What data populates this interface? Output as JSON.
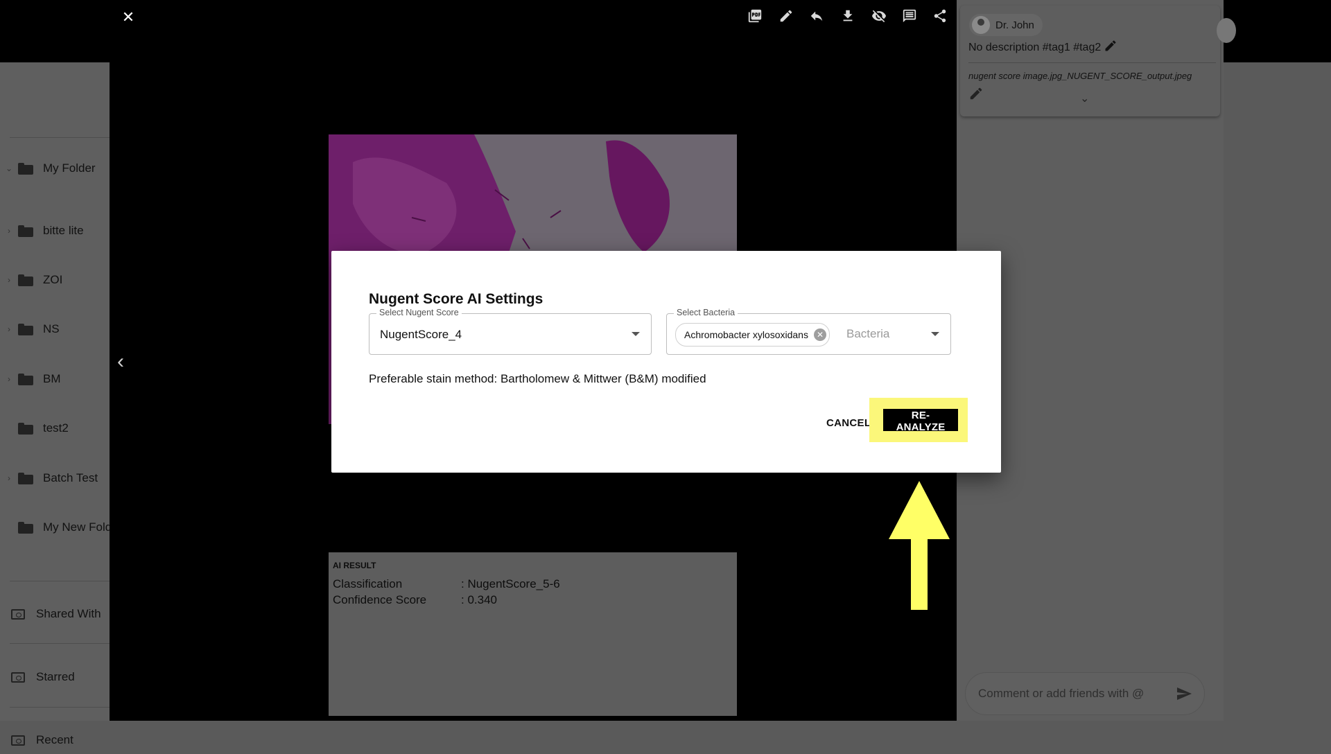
{
  "sidebar": {
    "items": [
      {
        "label": "My Folder",
        "expandable": true
      },
      {
        "label": "bitte lite",
        "expandable": true
      },
      {
        "label": "ZOI",
        "expandable": true
      },
      {
        "label": "NS",
        "expandable": true
      },
      {
        "label": "BM",
        "expandable": true
      },
      {
        "label": "test2",
        "expandable": false
      },
      {
        "label": "Batch Test",
        "expandable": true
      },
      {
        "label": "My New Folder",
        "expandable": false
      }
    ],
    "bottom_items": [
      {
        "label": "Shared With Me"
      },
      {
        "label": "Starred"
      },
      {
        "label": "Recent"
      }
    ]
  },
  "viewer": {
    "toolbar": [
      "pdf-icon",
      "pencil-icon",
      "reply-icon",
      "download-icon",
      "visibility-off-icon",
      "comment-icon",
      "share-icon"
    ],
    "close_glyph": "✕",
    "prev_glyph": "‹",
    "ai_result": {
      "title": "AI RESULT",
      "rows": [
        {
          "key": "Classification",
          "value": ": NugentScore_5-6"
        },
        {
          "key": "Confidence Score",
          "value": ": 0.340"
        }
      ]
    }
  },
  "right_panel": {
    "user": "Dr. John",
    "description": "No description #tag1 #tag2",
    "filename": "nugent score image.jpg_NUGENT_SCORE_output.jpeg",
    "comment_placeholder": "Comment or add friends with @"
  },
  "modal": {
    "title": "Nugent Score AI Settings",
    "nugent_field": {
      "label": "Select Nugent Score",
      "value": "NugentScore_4"
    },
    "bacteria_field": {
      "label": "Select Bacteria",
      "chip": "Achromobacter xylosoxidans",
      "placeholder": "Bacteria"
    },
    "stain_text": "Preferable stain method: Bartholomew & Mittwer (B&M) modified",
    "cancel_label": "CANCEL",
    "reanalyze_label": "RE-ANALYZE"
  },
  "colors": {
    "highlight": "#fbf77a",
    "arrow": "#ffff66",
    "overlay_dim": "#5a5a5a",
    "stain": "#a8209c"
  }
}
